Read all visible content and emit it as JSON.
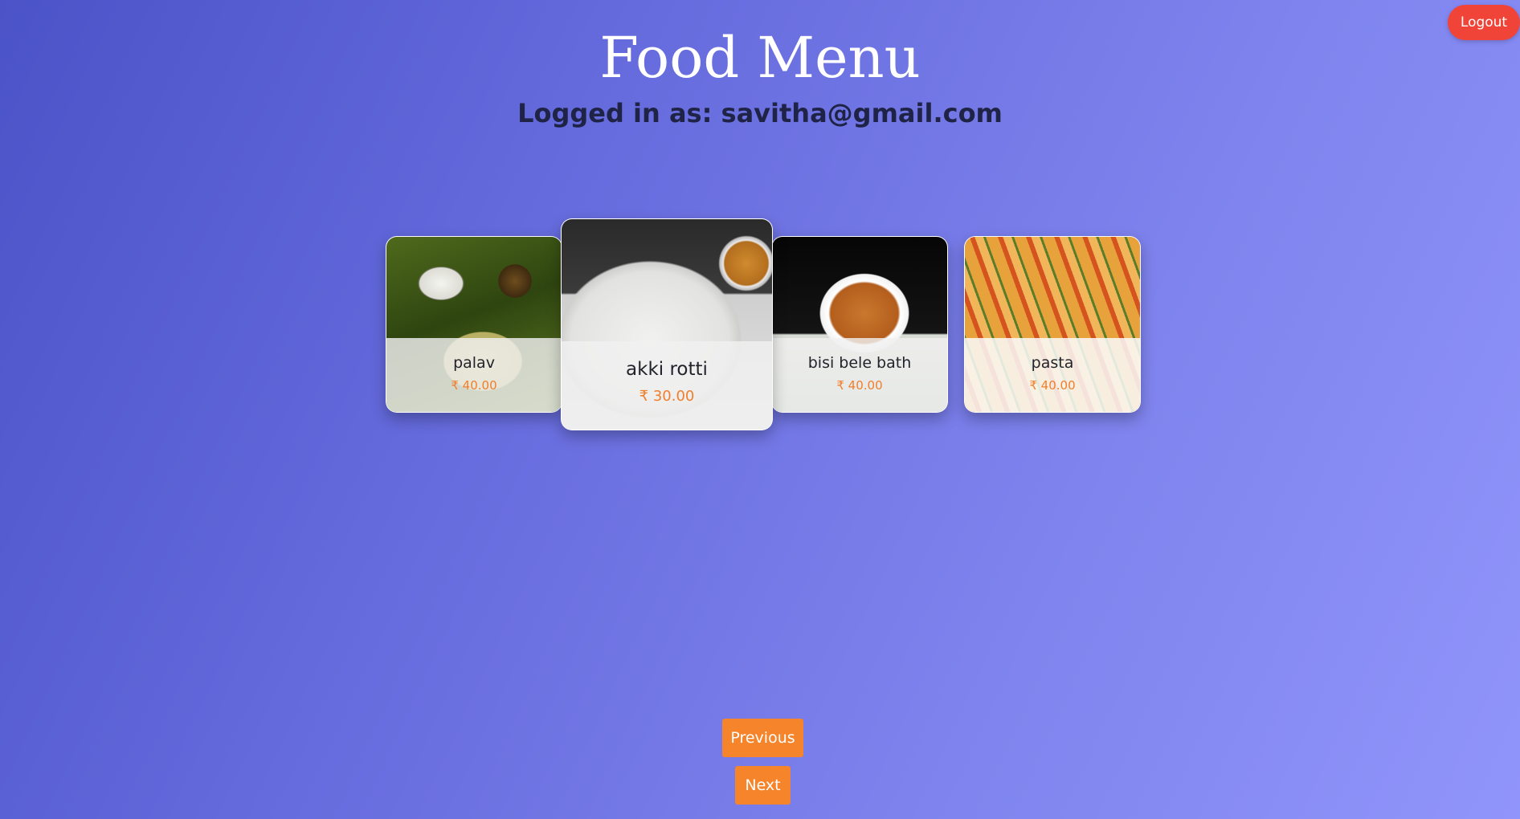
{
  "header": {
    "title": "Food Menu",
    "logged_in_text": "Logged in as: savitha@gmail.com",
    "logout_label": "Logout"
  },
  "menu": {
    "items": [
      {
        "name": "palav",
        "price": "₹ 40.00",
        "image": "palav-food-photo"
      },
      {
        "name": "akki rotti",
        "price": "₹ 30.00",
        "image": "akki-rotti-food-photo",
        "active": true
      },
      {
        "name": "bisi bele bath",
        "price": "₹ 40.00",
        "image": "bisi-bele-bath-food-photo"
      },
      {
        "name": "pasta",
        "price": "₹ 40.00",
        "image": "pasta-food-photo"
      }
    ]
  },
  "navigation": {
    "previous_label": "Previous",
    "next_label": "Next"
  },
  "colors": {
    "gradient_start": "#4b53c8",
    "gradient_end": "#9095fb",
    "logout": "#f04438",
    "nav_button": "#f5842a",
    "price": "#ef7f2b"
  }
}
